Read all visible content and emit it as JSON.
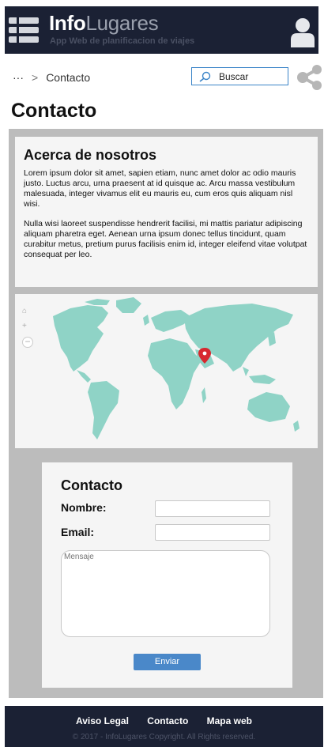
{
  "header": {
    "logo_bold": "Info",
    "logo_light": "Lugares",
    "tagline": "App Web de planificacion de viajes"
  },
  "breadcrumb": {
    "ellipsis": "···",
    "separator": ">",
    "current": "Contacto"
  },
  "search": {
    "label": "Buscar"
  },
  "page_title": "Contacto",
  "about": {
    "title": "Acerca de nosotros",
    "paragraph1": "Lorem ipsum dolor sit amet, sapien etiam, nunc amet dolor ac odio mauris justo. Luctus arcu, urna praesent at id quisque ac. Arcu massa vestibulum malesuada, integer vivamus elit eu mauris eu, cum eros quis aliquam nisl wisi.",
    "paragraph2": "Nulla wisi laoreet suspendisse hendrerit facilisi, mi mattis pariatur adipiscing aliquam pharetra eget. Aenean urna ipsum donec tellus tincidunt, quam curabitur metus, pretium purus facilisis enim id, integer eleifend vitae volutpat consequat per leo."
  },
  "map": {
    "zoom_in": "+",
    "zoom_out": "−",
    "home": "⌂"
  },
  "form": {
    "title": "Contacto",
    "name_label": "Nombre:",
    "email_label": "Email:",
    "message_placeholder": "Mensaje",
    "submit_label": "Enviar"
  },
  "footer": {
    "links": [
      "Aviso Legal",
      "Contacto",
      "Mapa web"
    ],
    "copyright": "© 2017 - InfoLugares Copyright. All Rights reserved."
  },
  "colors": {
    "header_bg": "#1b2134",
    "accent": "#4a88c9",
    "map_land": "#8fd3c6",
    "pin": "#d7282f"
  }
}
